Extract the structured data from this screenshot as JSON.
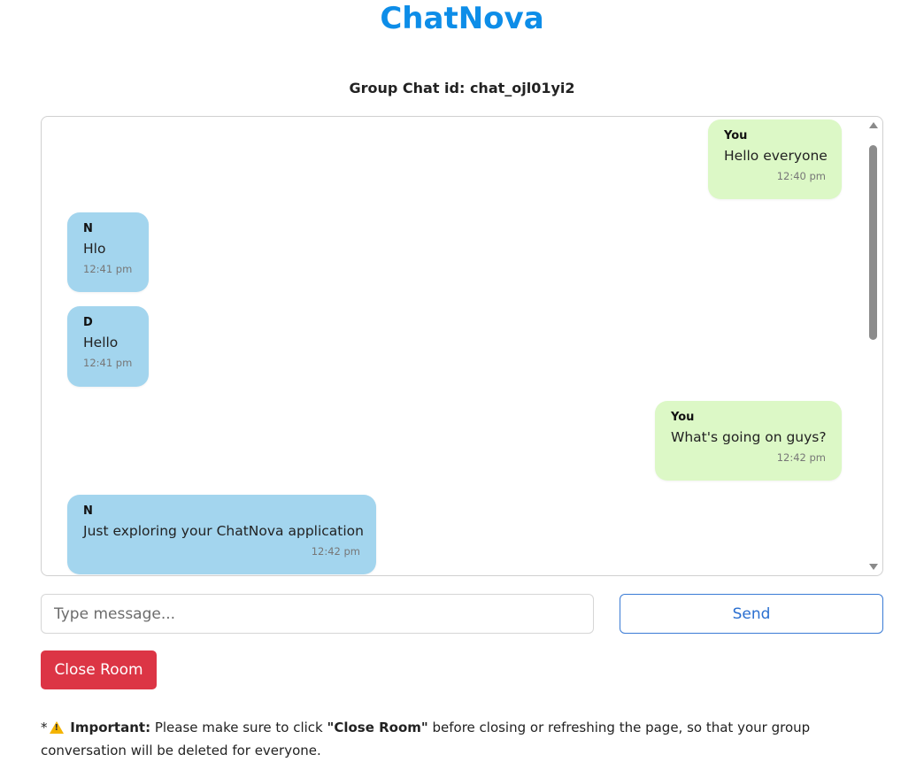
{
  "app": {
    "title": "ChatNova",
    "brand_color": "#0d8de8"
  },
  "chat": {
    "id_label": "Group Chat id: chat_ojl01yi2"
  },
  "messages": [
    {
      "sender": "You",
      "text": "Hello everyone",
      "time": "12:40 pm",
      "mine": true
    },
    {
      "sender": "N",
      "text": "Hlo",
      "time": "12:41 pm",
      "mine": false
    },
    {
      "sender": "D",
      "text": "Hello",
      "time": "12:41 pm",
      "mine": false
    },
    {
      "sender": "You",
      "text": "What's going on guys?",
      "time": "12:42 pm",
      "mine": true
    },
    {
      "sender": "N",
      "text": "Just exploring your ChatNova application",
      "time": "12:42 pm",
      "mine": false
    }
  ],
  "composer": {
    "placeholder": "Type message...",
    "value": "",
    "send_label": "Send"
  },
  "actions": {
    "close_room_label": "Close Room",
    "close_color": "#dc3545"
  },
  "notice": {
    "prefix": "*",
    "icon": "warning-icon",
    "important_label": "Important:",
    "text_before": " Please make sure to click ",
    "highlight": "\"Close Room\"",
    "text_after": " before closing or refreshing the page, so that your group conversation will be deleted for everyone."
  },
  "colors": {
    "my_bubble": "#dcf8c6",
    "other_bubble": "#a3d5ee"
  }
}
